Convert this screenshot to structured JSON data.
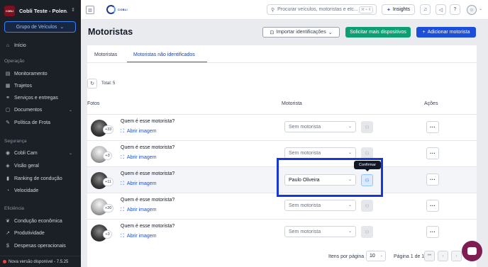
{
  "sidebar": {
    "org_logo_text": "COBLI",
    "org_name": "Cobli Teste - Polen...",
    "group_button": "Grupo de Veículos",
    "home": "Início",
    "section_operacao": "Operação",
    "operacao_items": [
      "Monitoramento",
      "Trajetos",
      "Serviços e entregas",
      "Documentos",
      "Política de Frota"
    ],
    "section_seguranca": "Segurança",
    "seguranca_items": [
      "Cobli Cam",
      "Visão geral",
      "Ranking de condução",
      "Velocidade"
    ],
    "section_eficiencia": "Eficiência",
    "eficiencia_items": [
      "Condução econômica",
      "Produtividade",
      "Despesas operacionais"
    ],
    "new_version": "Nova versão disponível - 7.5.25"
  },
  "topbar": {
    "brand": "COBLI",
    "search_placeholder": "Procurar veículos, motoristas e etc...",
    "search_shortcut": "⌘ + K",
    "insights_label": "Insights"
  },
  "page": {
    "title": "Motoristas",
    "import_button": "Importar identificações",
    "request_button": "Solicitar mais dispositivos",
    "add_button": "Adicionar motorista"
  },
  "tabs": [
    "Motoristas",
    "Motoristas não identificados"
  ],
  "total_label": "Total: 5",
  "columns": [
    "Fotos",
    "Motorista",
    "Ações"
  ],
  "rows": [
    {
      "count": "+33",
      "question": "Quem é esse motorista?",
      "link": "Abrir imagem",
      "driver": "Sem motorista"
    },
    {
      "count": "+3",
      "question": "Quem é esse motorista?",
      "link": "Abrir imagem",
      "driver": "Sem motorista"
    },
    {
      "count": "+11",
      "question": "Quem é esse motorista?",
      "link": "Abrir imagem",
      "driver": "Paulo Oliveira"
    },
    {
      "count": "+20",
      "question": "Quem é esse motorista?",
      "link": "Abrir imagem",
      "driver": "Sem motorista"
    },
    {
      "count": "+3",
      "question": "Quem é esse motorista?",
      "link": "Abrir imagem",
      "driver": "Sem motorista"
    }
  ],
  "tooltip": "Confirmar",
  "pagination": {
    "items_label": "Itens por página",
    "page_size": "10",
    "page_info": "Página 1 de 1"
  },
  "colors": {
    "primary": "#1d4ed8",
    "success": "#0d9f73",
    "sidebar_bg": "#1b1f26",
    "highlight_box": "#1638d6",
    "chat": "#7e1d52"
  }
}
